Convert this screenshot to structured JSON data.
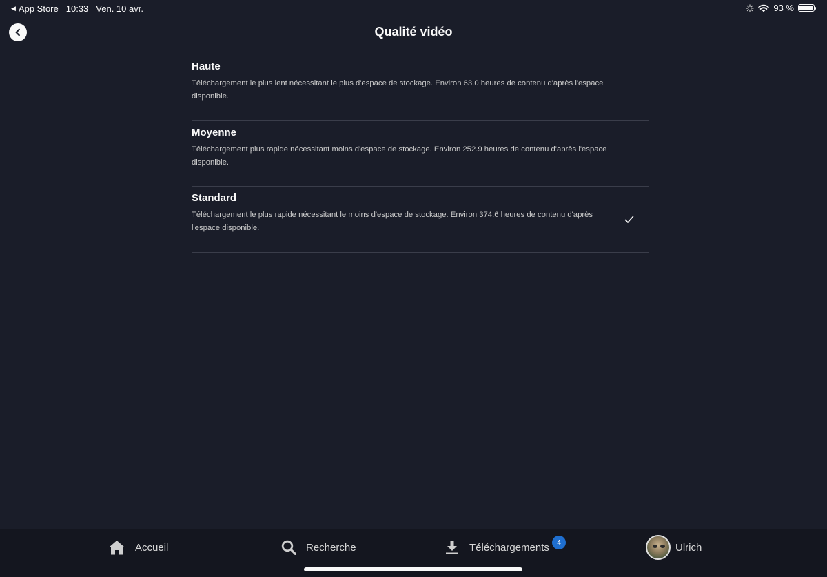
{
  "status_bar": {
    "back_app": "App Store",
    "time": "10:33",
    "date": "Ven. 10 avr.",
    "battery": "93 %",
    "battery_level": 0.93
  },
  "header": {
    "title": "Qualité vidéo"
  },
  "options": [
    {
      "title": "Haute",
      "description": "Téléchargement le plus lent nécessitant le plus d'espace de stockage. Environ 63.0 heures de contenu d'après l'espace disponible.",
      "selected": false
    },
    {
      "title": "Moyenne",
      "description": "Téléchargement plus rapide nécessitant moins d'espace de stockage. Environ 252.9 heures de contenu d'après l'espace disponible.",
      "selected": false
    },
    {
      "title": "Standard",
      "description": "Téléchargement le plus rapide nécessitant le moins d'espace de stockage. Environ 374.6 heures de contenu d'après l'espace disponible.",
      "selected": true
    }
  ],
  "tab_bar": {
    "home": "Accueil",
    "search": "Recherche",
    "downloads": "Téléchargements",
    "downloads_badge": "4",
    "profile": "Ulrich"
  },
  "colors": {
    "background": "#1a1d29",
    "tab_bar": "#14161f",
    "badge": "#1f6fd0"
  }
}
